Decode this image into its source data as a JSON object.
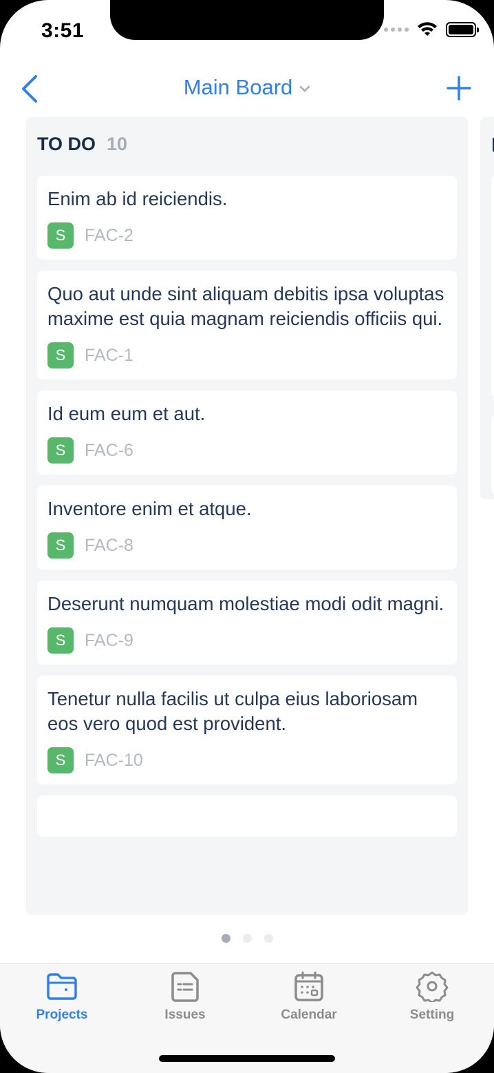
{
  "status": {
    "time": "3:51"
  },
  "nav": {
    "title": "Main Board"
  },
  "column": {
    "title": "TO DO",
    "count": "10",
    "cards": [
      {
        "title": "Enim ab id reiciendis.",
        "badge": "S",
        "key": "FAC-2"
      },
      {
        "title": "Quo aut unde sint aliquam debitis ipsa voluptas maxime est quia magnam reiciendis officiis qui.",
        "badge": "S",
        "key": "FAC-1"
      },
      {
        "title": "Id eum eum et aut.",
        "badge": "S",
        "key": "FAC-6"
      },
      {
        "title": "Inventore enim et atque.",
        "badge": "S",
        "key": "FAC-8"
      },
      {
        "title": "Deserunt numquam molestiae modi odit magni.",
        "badge": "S",
        "key": "FAC-9"
      },
      {
        "title": "Tenetur nulla facilis ut culpa eius laboriosam eos vero quod est provident.",
        "badge": "S",
        "key": "FAC-10"
      }
    ]
  },
  "tabs": [
    {
      "label": "Projects",
      "icon": "folder-icon",
      "active": true
    },
    {
      "label": "Issues",
      "icon": "issues-icon",
      "active": false
    },
    {
      "label": "Calendar",
      "icon": "calendar-icon",
      "active": false
    },
    {
      "label": "Setting",
      "icon": "gear-icon",
      "active": false
    }
  ],
  "colors": {
    "accent": "#2f80ed",
    "badge": "#57b86c",
    "column_bg": "#f4f5f7",
    "text": "#253858"
  }
}
